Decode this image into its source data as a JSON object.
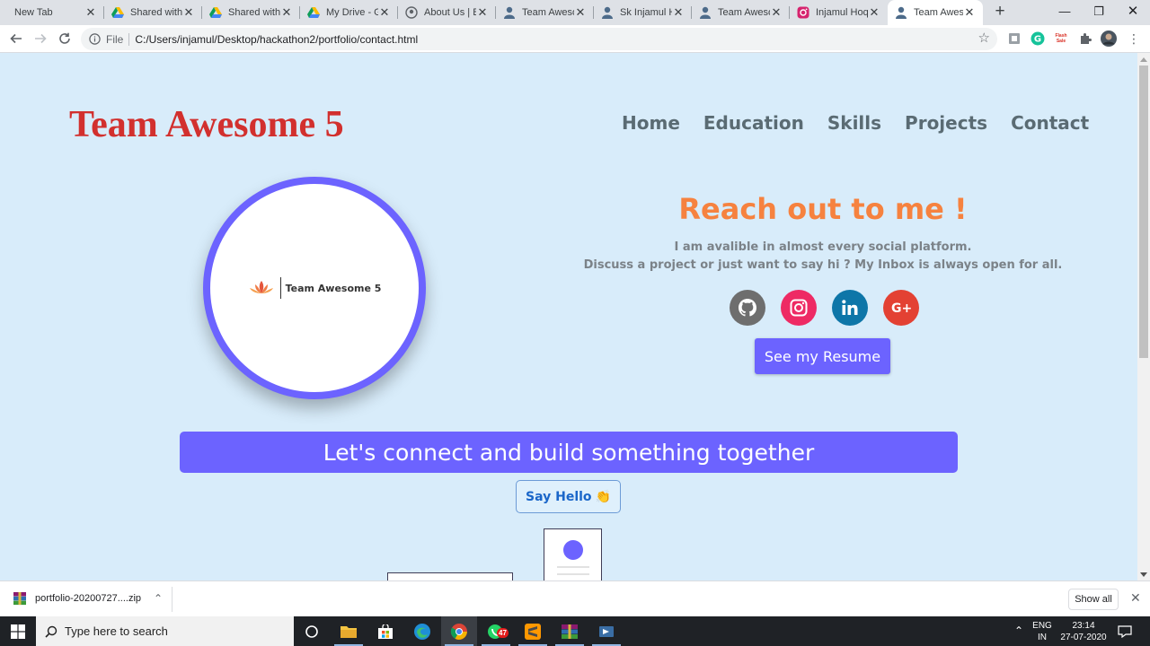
{
  "browser": {
    "tabs": [
      {
        "title": "New Tab",
        "icon": "none"
      },
      {
        "title": "Shared with",
        "icon": "google-drive-icon"
      },
      {
        "title": "Shared with",
        "icon": "google-drive-icon"
      },
      {
        "title": "My Drive - G",
        "icon": "google-drive-icon"
      },
      {
        "title": "About Us | B",
        "icon": "globe-icon"
      },
      {
        "title": "Team Aweso",
        "icon": "person-icon"
      },
      {
        "title": "Sk Injamul H",
        "icon": "person-icon"
      },
      {
        "title": "Team Aweso",
        "icon": "person-icon"
      },
      {
        "title": "Injamul Hoq",
        "icon": "instagram-icon"
      },
      {
        "title": "Team Aweso",
        "icon": "person-icon"
      }
    ],
    "active_tab_index": 9,
    "address": {
      "scheme_label": "File",
      "url": "C:/Users/injamul/Desktop/hackathon2/portfolio/contact.html"
    },
    "extension_flash_label": "Flash Sale"
  },
  "page": {
    "brand": "Team Awesome 5",
    "nav": [
      "Home",
      "Education",
      "Skills",
      "Projects",
      "Contact"
    ],
    "logo_text": "Team Awesome 5",
    "heading": "Reach out to me !",
    "description_line1": "I am avalible in almost every social platform.",
    "description_line2": "Discuss a project or just want to say hi ? My Inbox is always open for all.",
    "socials": [
      {
        "name": "github-icon",
        "color": "#6e6e6e"
      },
      {
        "name": "instagram-icon",
        "color": "#ee2a64"
      },
      {
        "name": "linkedin-icon",
        "color": "#0e76a8"
      },
      {
        "name": "google-plus-icon",
        "color": "#e34133"
      }
    ],
    "resume_button": "See my Resume",
    "connect_banner": "Let's connect and build something together",
    "hello_button": "Say Hello",
    "hello_emoji": "👏",
    "colors": {
      "accent": "#6c63ff",
      "brand": "#d2302e",
      "heading": "#f6823f",
      "background": "#d8ecfa"
    }
  },
  "downloads": {
    "file_name": "portfolio-20200727....zip",
    "show_all": "Show all"
  },
  "taskbar": {
    "search_placeholder": "Type here to search",
    "whatsapp_badge": "47",
    "lang_primary": "ENG",
    "lang_secondary": "IN",
    "time": "23:14",
    "date": "27-07-2020"
  }
}
